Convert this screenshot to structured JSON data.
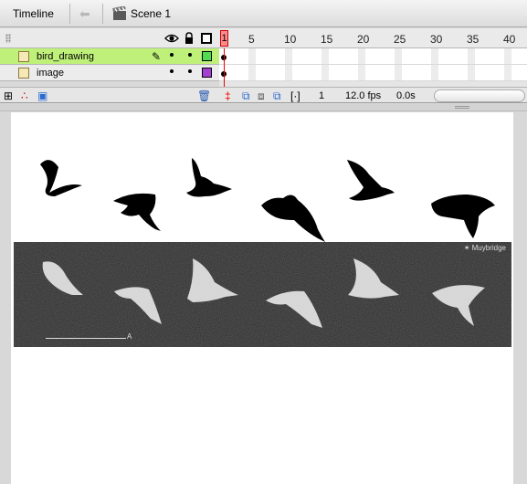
{
  "topbar": {
    "tab_label": "Timeline",
    "scene_label": "Scene 1",
    "back_icon": "arrow-left-icon",
    "scene_icon": "clapperboard-icon"
  },
  "timeline": {
    "header_icons": [
      "eye-icon",
      "lock-icon",
      "outline-icon"
    ],
    "ruler_labels": [
      "1",
      "5",
      "10",
      "15",
      "20",
      "25",
      "30",
      "35",
      "40"
    ],
    "current_frame": "1",
    "layers": [
      {
        "name": "bird_drawing",
        "color": "#4fdc4f",
        "selected": true
      },
      {
        "name": "image",
        "color": "#a43fd4",
        "selected": false
      }
    ]
  },
  "status": {
    "frame": "1",
    "fps": "12.0 fps",
    "time": "0.0s"
  },
  "photo": {
    "top_right_mark": "✶ Muybridge",
    "bottom_mark": "A"
  },
  "colors": {
    "selected_layer": "#bff07a",
    "playhead": "#ff8a8a"
  }
}
